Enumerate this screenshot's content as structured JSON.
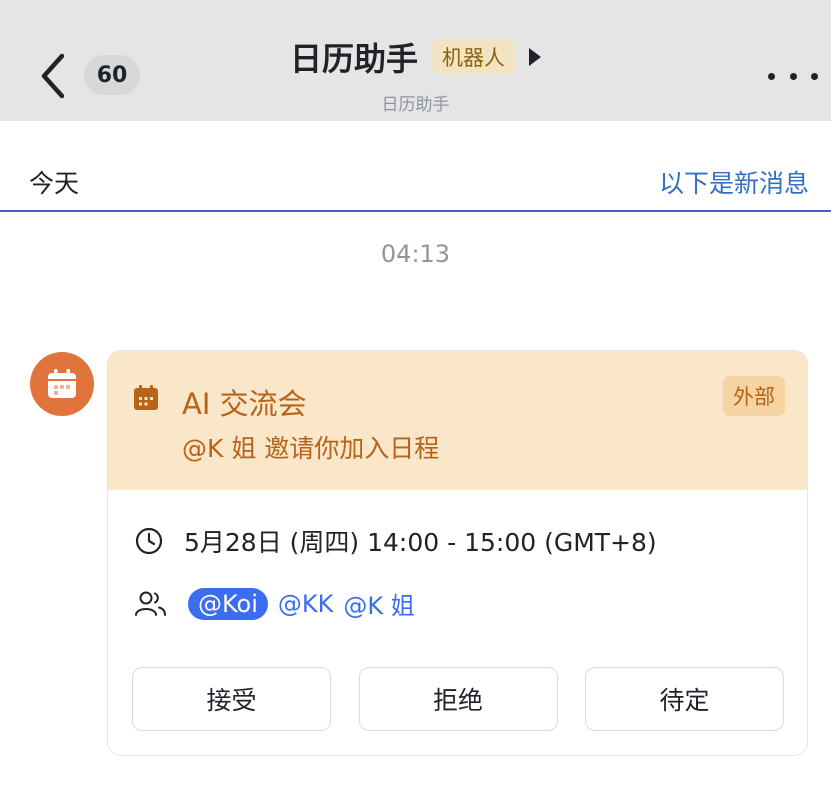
{
  "header": {
    "unread_count": "60",
    "title": "日历助手",
    "bot_tag": "机器人",
    "subtitle": "日历助手"
  },
  "divider": {
    "left_label": "今天",
    "right_label": "以下是新消息"
  },
  "message": {
    "time": "04:13",
    "card": {
      "event_title": "AI 交流会",
      "external_tag": "外部",
      "invite_text": "@K 姐 邀请你加入日程",
      "datetime": "5月28日 (周四) 14:00 - 15:00 (GMT+8)",
      "attendees": [
        "@Koi",
        "@KK",
        "@K 姐"
      ],
      "buttons": {
        "accept": "接受",
        "decline": "拒绝",
        "tentative": "待定"
      }
    }
  },
  "colors": {
    "header_bg": "#e5e5e6",
    "accent_blue": "#3370c4",
    "card_head_bg": "#fae6c8",
    "card_head_text": "#b8621a",
    "avatar_bg": "#e0743c",
    "mention_blue": "#3c6cf0"
  },
  "icons": [
    "chevron-left-icon",
    "play-triangle-icon",
    "more-dots-icon",
    "calendar-icon",
    "clock-icon",
    "people-icon"
  ]
}
